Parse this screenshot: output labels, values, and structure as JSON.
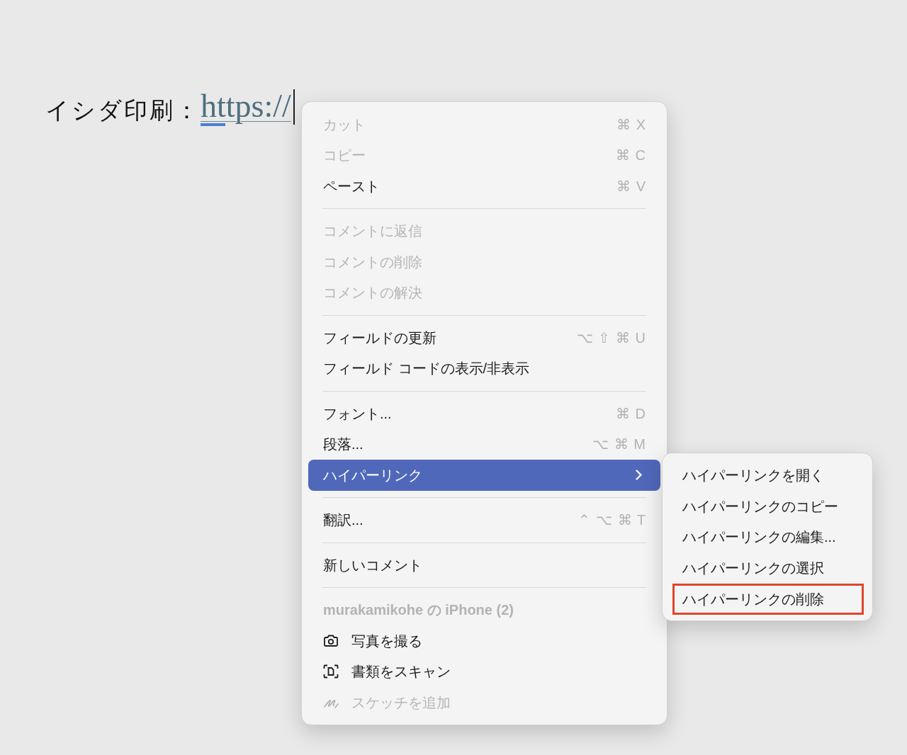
{
  "document": {
    "label": "イシダ印刷：",
    "link": "https://"
  },
  "context_menu": {
    "items": [
      {
        "kind": "command",
        "label": "カット",
        "shortcut": "⌘ X",
        "disabled": true,
        "selected": false,
        "submenu": false
      },
      {
        "kind": "command",
        "label": "コピー",
        "shortcut": "⌘ C",
        "disabled": true,
        "selected": false,
        "submenu": false
      },
      {
        "kind": "command",
        "label": "ペースト",
        "shortcut": "⌘ V",
        "disabled": false,
        "selected": false,
        "submenu": false
      },
      {
        "kind": "separator"
      },
      {
        "kind": "command",
        "label": "コメントに返信",
        "disabled": true,
        "selected": false,
        "submenu": false
      },
      {
        "kind": "command",
        "label": "コメントの削除",
        "disabled": true,
        "selected": false,
        "submenu": false
      },
      {
        "kind": "command",
        "label": "コメントの解決",
        "disabled": true,
        "selected": false,
        "submenu": false
      },
      {
        "kind": "separator"
      },
      {
        "kind": "command",
        "label": "フィールドの更新",
        "shortcut": "⌥ ⇧ ⌘ U",
        "disabled": false,
        "selected": false,
        "submenu": false
      },
      {
        "kind": "command",
        "label": "フィールド コードの表示/非表示",
        "disabled": false,
        "selected": false,
        "submenu": false
      },
      {
        "kind": "separator"
      },
      {
        "kind": "command",
        "label": "フォント...",
        "shortcut": "⌘ D",
        "disabled": false,
        "selected": false,
        "submenu": false
      },
      {
        "kind": "command",
        "label": "段落...",
        "shortcut": "⌥ ⌘ M",
        "disabled": false,
        "selected": false,
        "submenu": false
      },
      {
        "kind": "command",
        "label": "ハイパーリンク",
        "disabled": false,
        "selected": true,
        "submenu": true
      },
      {
        "kind": "separator"
      },
      {
        "kind": "command",
        "label": "翻訳...",
        "shortcut": "⌃ ⌥ ⌘ T",
        "disabled": false,
        "selected": false,
        "submenu": false
      },
      {
        "kind": "separator"
      },
      {
        "kind": "command",
        "label": "新しいコメント",
        "disabled": false,
        "selected": false,
        "submenu": false
      },
      {
        "kind": "separator"
      },
      {
        "kind": "header",
        "label": "murakamikohe の iPhone (2)"
      },
      {
        "kind": "camera",
        "label": "写真を撮る",
        "disabled": false,
        "selected": false,
        "submenu": false
      },
      {
        "kind": "scan",
        "label": "書類をスキャン",
        "disabled": false,
        "selected": false,
        "submenu": false
      },
      {
        "kind": "sketch",
        "label": "スケッチを追加",
        "disabled": true,
        "selected": false,
        "submenu": false
      }
    ]
  },
  "submenu": {
    "items": [
      {
        "label": "ハイパーリンクを開く",
        "annotated": false
      },
      {
        "label": "ハイパーリンクのコピー",
        "annotated": false
      },
      {
        "label": "ハイパーリンクの編集...",
        "annotated": false
      },
      {
        "label": "ハイパーリンクの選択",
        "annotated": false
      },
      {
        "label": "ハイパーリンクの削除",
        "annotated": true
      }
    ]
  }
}
